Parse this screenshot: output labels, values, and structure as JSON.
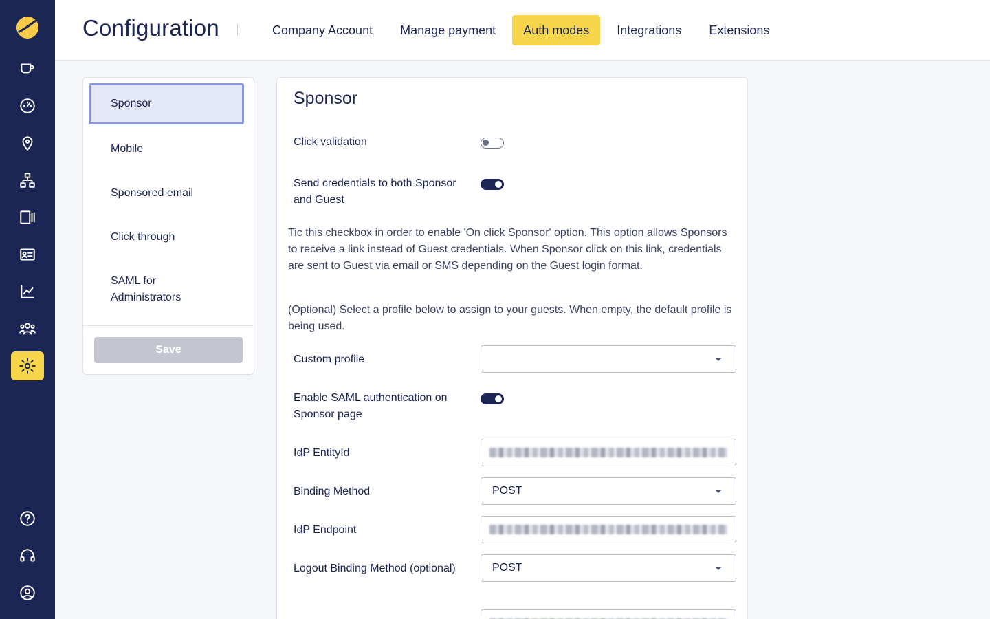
{
  "app": {
    "icons": [
      "logo-icon",
      "coffee-icon",
      "speedometer-icon",
      "location-pin-icon",
      "network-icon",
      "devices-icon",
      "id-card-icon",
      "chart-line-icon",
      "users-icon",
      "gear-icon",
      "help-icon",
      "headset-icon",
      "user-circle-icon"
    ],
    "accent_color": "#f7d54a",
    "sidebar_color": "#1c2654"
  },
  "header": {
    "title": "Configuration",
    "tabs": [
      {
        "label": "Company Account",
        "active": false
      },
      {
        "label": "Manage payment",
        "active": false
      },
      {
        "label": "Auth modes",
        "active": true
      },
      {
        "label": "Integrations",
        "active": false
      },
      {
        "label": "Extensions",
        "active": false
      }
    ]
  },
  "menu": {
    "items": [
      {
        "label": "Sponsor",
        "active": true
      },
      {
        "label": "Mobile",
        "active": false
      },
      {
        "label": "Sponsored email",
        "active": false
      },
      {
        "label": "Click through",
        "active": false
      },
      {
        "label": "SAML for Administrators",
        "active": false
      }
    ],
    "save_label": "Save"
  },
  "form": {
    "title": "Sponsor",
    "click_validation": {
      "label": "Click validation",
      "enabled": false
    },
    "send_credentials": {
      "label": "Send credentials to both Sponsor and Guest",
      "enabled": true
    },
    "description_1": "Tic this checkbox in order to enable 'On click Sponsor' option. This option allows Sponsors to receive a link instead of Guest credentials. When Sponsor click on this link, credentials are sent to Guest via email or SMS depending on the Guest login format.",
    "description_2": "(Optional) Select a profile below to assign to your guests. When empty, the default profile is being used.",
    "custom_profile": {
      "label": "Custom profile",
      "value": ""
    },
    "enable_saml": {
      "label": "Enable SAML authentication on Sponsor page",
      "enabled": true
    },
    "idp_entity_id": {
      "label": "IdP EntityId"
    },
    "binding_method": {
      "label": "Binding Method",
      "value": "POST"
    },
    "idp_endpoint": {
      "label": "IdP Endpoint"
    },
    "logout_binding_method": {
      "label": "Logout Binding Method (optional)",
      "value": "POST"
    }
  }
}
